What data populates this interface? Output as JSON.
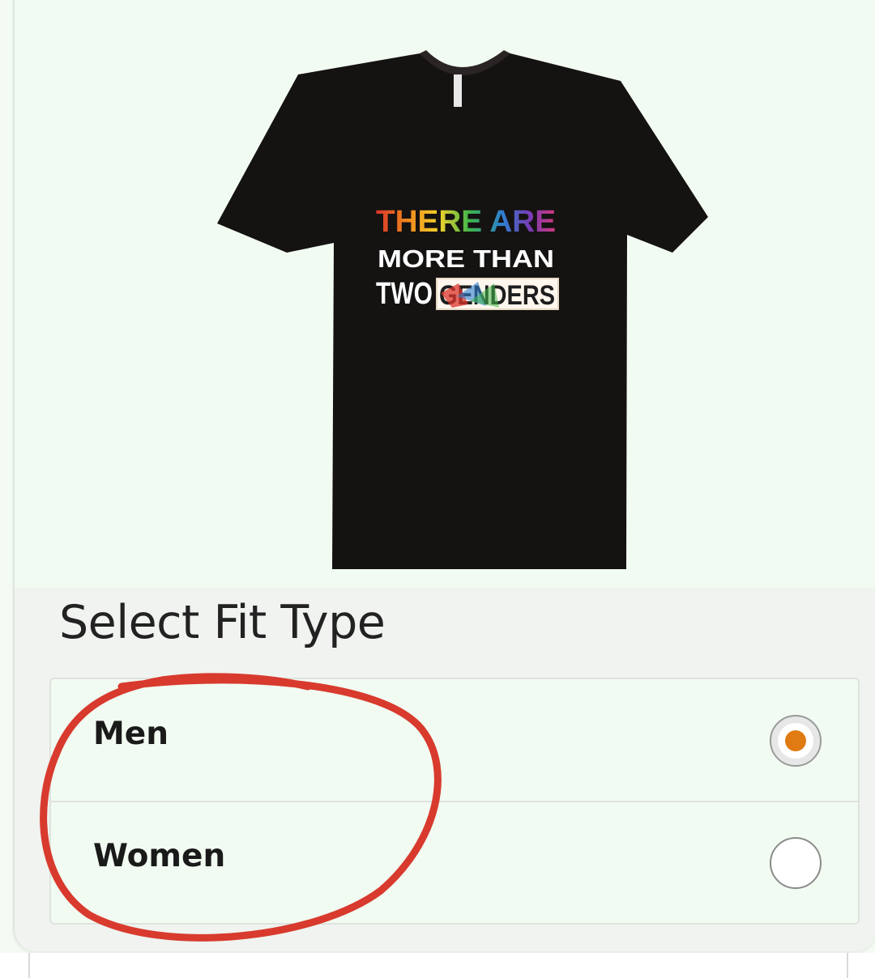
{
  "product": {
    "shirt_text": {
      "line1": "THERE ARE",
      "line2": "MORE THAN",
      "line3a": "TWO",
      "line3b": "GENDERS"
    }
  },
  "fit": {
    "title": "Select Fit Type",
    "options": [
      {
        "label": "Men",
        "selected": true
      },
      {
        "label": "Women",
        "selected": false
      }
    ]
  },
  "colors": {
    "selected_radio": "#e07a13",
    "annotation_circle": "#d83a2e",
    "shirt": "#151212"
  },
  "icons": {
    "selected": "radio-selected-icon",
    "unselected": "radio-unselected-icon"
  }
}
